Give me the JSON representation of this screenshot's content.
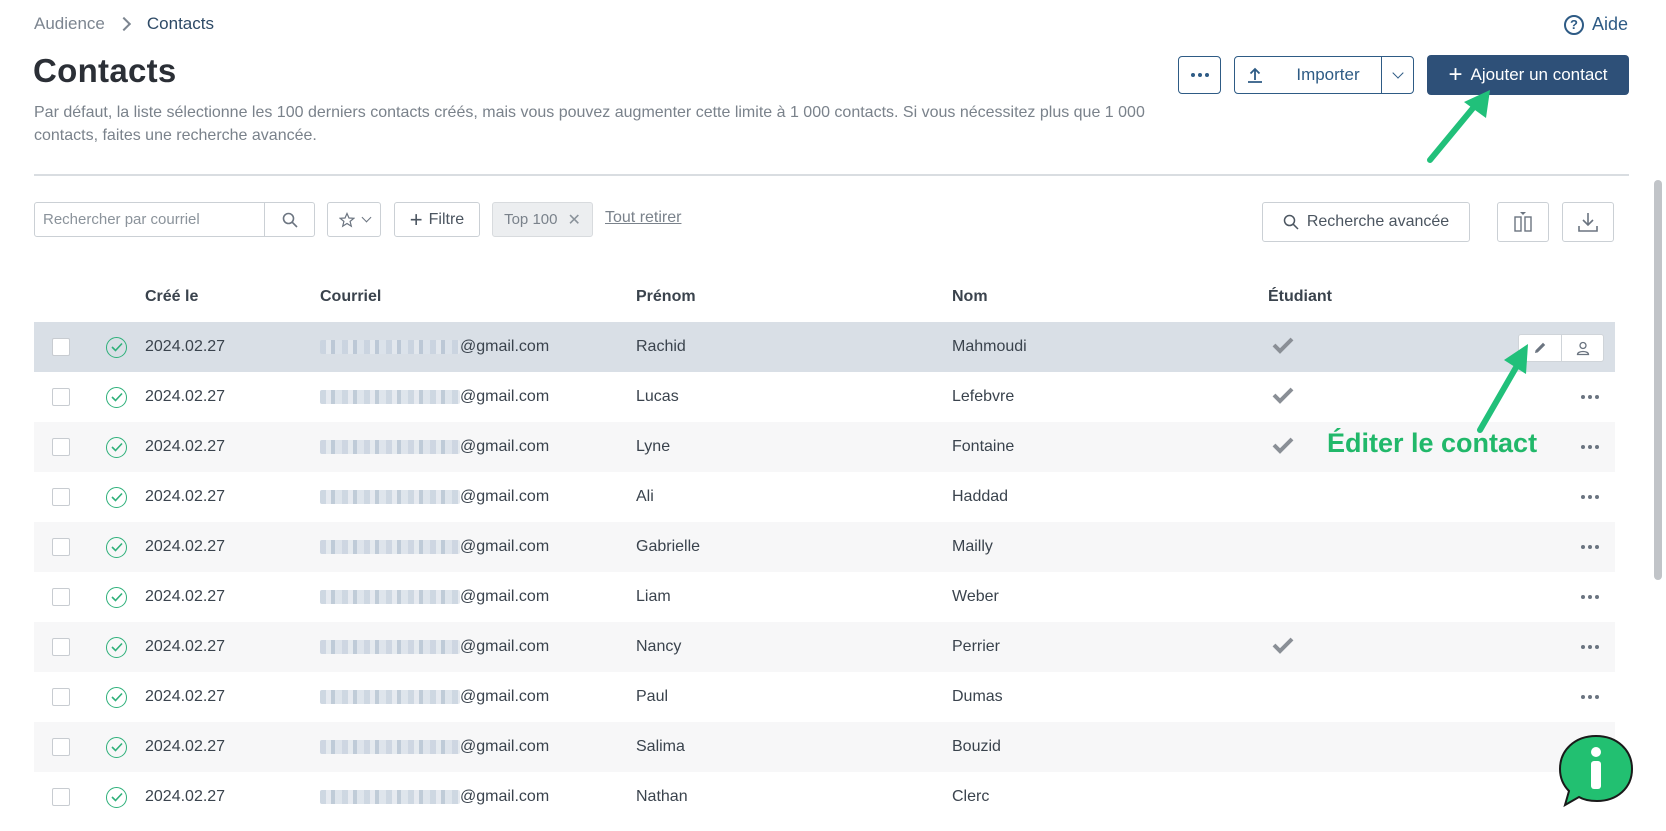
{
  "breadcrumb": {
    "parent": "Audience",
    "current": "Contacts"
  },
  "help": {
    "label": "Aide"
  },
  "page": {
    "title": "Contacts",
    "description": "Par défaut, la liste sélectionne les 100 derniers contacts créés, mais vous pouvez augmenter cette limite à 1 000 contacts. Si vous nécessitez plus que 1 000 contacts, faites une recherche avancée."
  },
  "actions": {
    "import_label": "Importer",
    "add_label": "Ajouter un contact"
  },
  "toolbar": {
    "search_placeholder": "Rechercher par courriel",
    "filter_label": "Filtre",
    "chip_label": "Top 100",
    "clear_label": "Tout retirer",
    "advanced_label": "Recherche avancée"
  },
  "table": {
    "headers": {
      "created": "Créé le",
      "email": "Courriel",
      "firstname": "Prénom",
      "lastname": "Nom",
      "student": "Étudiant"
    },
    "rows": [
      {
        "date": "2024.02.27",
        "email": "@gmail.com",
        "firstname": "Rachid",
        "lastname": "Mahmoudi",
        "student": true
      },
      {
        "date": "2024.02.27",
        "email": "@gmail.com",
        "firstname": "Lucas",
        "lastname": "Lefebvre",
        "student": true
      },
      {
        "date": "2024.02.27",
        "email": "@gmail.com",
        "firstname": "Lyne",
        "lastname": "Fontaine",
        "student": true
      },
      {
        "date": "2024.02.27",
        "email": "@gmail.com",
        "firstname": "Ali",
        "lastname": "Haddad",
        "student": false
      },
      {
        "date": "2024.02.27",
        "email": "@gmail.com",
        "firstname": "Gabrielle",
        "lastname": "Mailly",
        "student": false
      },
      {
        "date": "2024.02.27",
        "email": "@gmail.com",
        "firstname": "Liam",
        "lastname": "Weber",
        "student": false
      },
      {
        "date": "2024.02.27",
        "email": "@gmail.com",
        "firstname": "Nancy",
        "lastname": "Perrier",
        "student": true
      },
      {
        "date": "2024.02.27",
        "email": "@gmail.com",
        "firstname": "Paul",
        "lastname": "Dumas",
        "student": false
      },
      {
        "date": "2024.02.27",
        "email": "@gmail.com",
        "firstname": "Salima",
        "lastname": "Bouzid",
        "student": false
      },
      {
        "date": "2024.02.27",
        "email": "@gmail.com",
        "firstname": "Nathan",
        "lastname": "Clerc",
        "student": false
      }
    ]
  },
  "annotation": {
    "edit_label": "Éditer le contact"
  },
  "colors": {
    "primary": "#2e5078",
    "accent_green": "#21b86a",
    "status_green": "#2eb07a",
    "row_highlight": "#d9dfe6"
  },
  "icons": [
    "chevron-right-icon",
    "help-icon",
    "more-icon",
    "upload-icon",
    "chevron-down-icon",
    "plus-icon",
    "search-icon",
    "star-icon",
    "close-icon",
    "columns-icon",
    "download-icon",
    "check-circle-icon",
    "checkmark-icon",
    "pencil-icon",
    "user-icon",
    "info-icon"
  ]
}
